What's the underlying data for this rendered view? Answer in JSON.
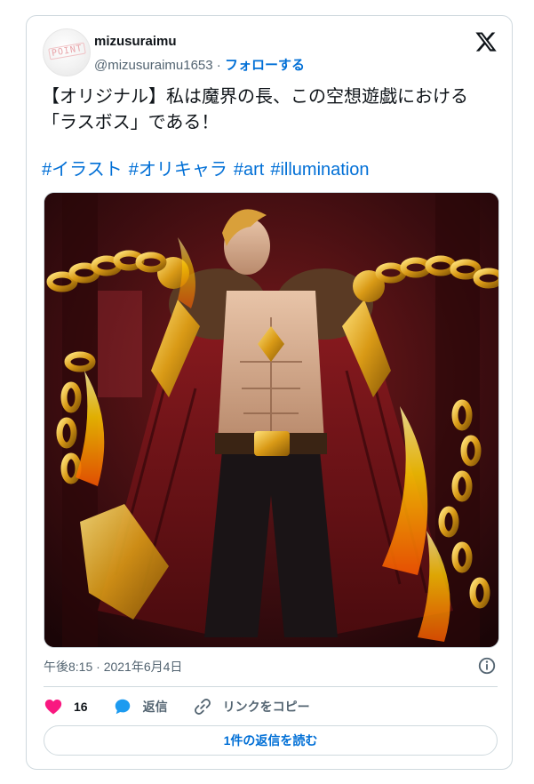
{
  "author": {
    "display_name": "mizusuraimu",
    "handle": "@mizusuraimu1653",
    "separator": " · ",
    "follow_label": "フォローする",
    "avatar_text": "POINT"
  },
  "tweet": {
    "text": "【オリジナル】私は魔界の長、この空想遊戯における「ラスボス」である！",
    "hashtags": [
      "#イラスト",
      "#オリキャラ",
      "#art",
      "#illumination"
    ],
    "timestamp": "午後8:15 · 2021年6月4日"
  },
  "actions": {
    "like_count": "16",
    "reply_label": "返信",
    "copy_link_label": "リンクをコピー"
  },
  "read_replies_label": "1件の返信を読む",
  "icons": {
    "logo": "x-logo-icon",
    "info": "info-icon",
    "like": "heart-icon",
    "reply": "reply-bubble-icon",
    "copy_link": "link-icon"
  },
  "colors": {
    "link": "#006fd6",
    "like": "#f91880",
    "reply": "#1d9bf0",
    "secondary_text": "#536471",
    "border": "#cfd9de"
  }
}
